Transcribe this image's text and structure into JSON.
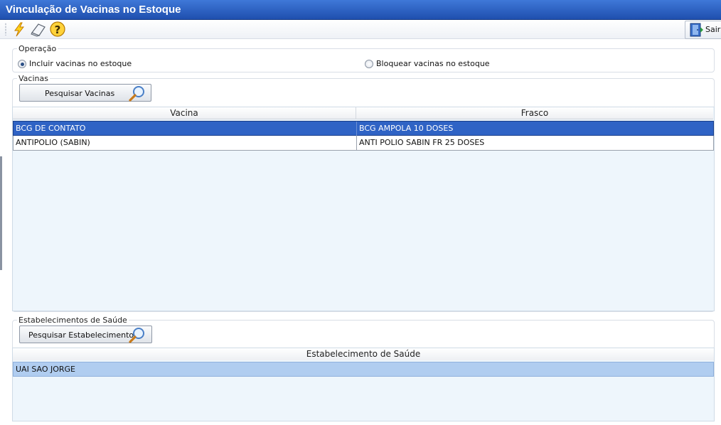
{
  "window": {
    "title": "Vinculação de Vacinas no Estoque"
  },
  "toolbar": {
    "icons": [
      "lightning-icon",
      "eraser-icon",
      "help-icon"
    ],
    "exit_label": "Sair"
  },
  "operacao": {
    "legend": "Operação",
    "options": [
      {
        "label": "Incluir vacinas no estoque",
        "checked": true
      },
      {
        "label": "Bloquear vacinas no estoque",
        "checked": false
      }
    ]
  },
  "vacinas": {
    "legend": "Vacinas",
    "search_label": "Pesquisar Vacinas",
    "columns": [
      "Vacina",
      "Frasco"
    ],
    "rows": [
      {
        "vacina": "BCG DE CONTATO",
        "frasco": "BCG AMPOLA 10 DOSES",
        "selected": true
      },
      {
        "vacina": "ANTIPOLIO (SABIN)",
        "frasco": "ANTI POLIO SABIN FR 25 DOSES",
        "selected": false
      }
    ]
  },
  "estabelecimentos": {
    "legend": "Estabelecimentos de Saúde",
    "search_label": "Pesquisar Estabelecimentos",
    "columns": [
      "Estabelecimento de Saúde"
    ],
    "rows": [
      {
        "nome": "UAI SAO JORGE",
        "selected": true
      }
    ]
  },
  "colors": {
    "title_bar": "#2a5fc4",
    "selected_row": "#2f63c5",
    "highlight_row": "#b0cdf0",
    "grid_background": "#eef6fc"
  }
}
